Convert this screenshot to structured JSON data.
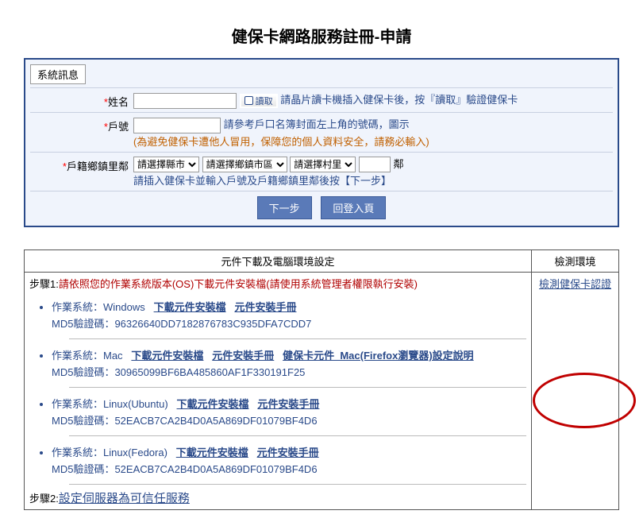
{
  "page_title": "健保卡網路服務註冊-申請",
  "sysmsg_tab": "系統訊息",
  "form": {
    "name_label": "姓名",
    "read_btn": "讀取",
    "name_hint": "請晶片讀卡機插入健保卡後，按『讀取』驗證健保卡",
    "household_label": "戶號",
    "household_hint": "請參考戶口名簿封面左上角的號碼，圖示",
    "household_warn": "(為避免健保卡遭他人冒用，保障您的個人資料安全，請務必輸入)",
    "addr_label": "戶籍鄉鎮里鄰",
    "sel_county": "請選擇縣市",
    "sel_town": "請選擇鄉鎮市區",
    "sel_village": "請選擇村里",
    "addr_suffix": "鄰",
    "addr_hint": "請插入健保卡並輸入戶號及戶籍鄉鎮里鄰後按【下一步】",
    "btn_next": "下一步",
    "btn_back": "回登入頁"
  },
  "dl": {
    "header_left": "元件下載及電腦環境設定",
    "header_right": "檢測環境",
    "step1_label": "步驟1:",
    "step1_text": "請依照您的作業系統版本(OS)下載元件安裝檔(請使用系統管理者權限執行安裝)",
    "os": [
      {
        "name": "作業系統：Windows",
        "links": [
          "下載元件安裝檔",
          "元件安裝手冊"
        ],
        "md5": "MD5驗證碼：96326640DD7182876783C935DFA7CDD7"
      },
      {
        "name": "作業系統：Mac",
        "links": [
          "下載元件安裝檔",
          "元件安裝手冊",
          "健保卡元件_Mac(Firefox瀏覽器)設定說明"
        ],
        "md5": "MD5驗證碼：30965099BF6BA485860AF1F330191F25"
      },
      {
        "name": "作業系統：Linux(Ubuntu)",
        "links": [
          "下載元件安裝檔",
          "元件安裝手冊"
        ],
        "md5": "MD5驗證碼：52EACB7CA2B4D0A5A869DF01079BF4D6"
      },
      {
        "name": "作業系統：Linux(Fedora)",
        "links": [
          "下載元件安裝檔",
          "元件安裝手冊"
        ],
        "md5": "MD5驗證碼：52EACB7CA2B4D0A5A869DF01079BF4D6"
      }
    ],
    "detect_link": "檢測健保卡認證",
    "step2_label": "步驟2:",
    "step2_link": "設定伺服器為可信任服務"
  }
}
